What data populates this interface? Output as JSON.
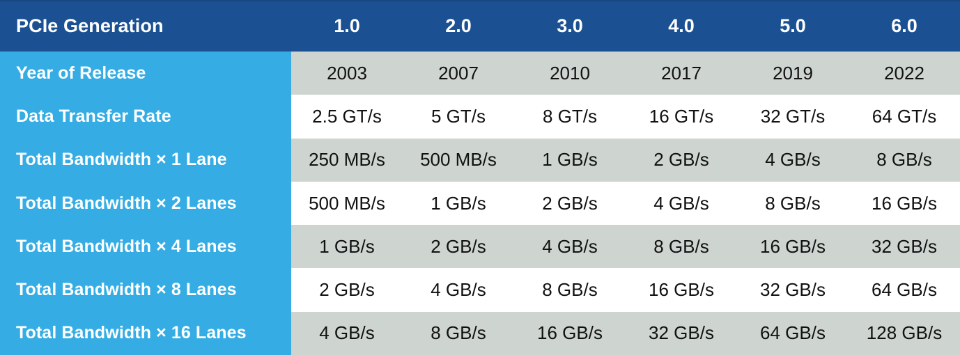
{
  "table": {
    "header": {
      "label": "PCIe Generation",
      "generations": [
        "1.0",
        "2.0",
        "3.0",
        "4.0",
        "5.0",
        "6.0"
      ]
    },
    "rows": [
      {
        "label": "Year of Release",
        "values": [
          "2003",
          "2007",
          "2010",
          "2017",
          "2019",
          "2022"
        ],
        "shade": "gray"
      },
      {
        "label": "Data Transfer Rate",
        "values": [
          "2.5 GT/s",
          "5 GT/s",
          "8 GT/s",
          "16 GT/s",
          "32 GT/s",
          "64 GT/s"
        ],
        "shade": "white"
      },
      {
        "label": "Total Bandwidth × 1 Lane",
        "values": [
          "250 MB/s",
          "500 MB/s",
          "1 GB/s",
          "2 GB/s",
          "4 GB/s",
          "8 GB/s"
        ],
        "shade": "gray"
      },
      {
        "label": "Total Bandwidth × 2 Lanes",
        "values": [
          "500 MB/s",
          "1 GB/s",
          "2 GB/s",
          "4 GB/s",
          "8 GB/s",
          "16 GB/s"
        ],
        "shade": "white"
      },
      {
        "label": "Total Bandwidth × 4 Lanes",
        "values": [
          "1 GB/s",
          "2 GB/s",
          "4 GB/s",
          "8 GB/s",
          "16 GB/s",
          "32 GB/s"
        ],
        "shade": "gray"
      },
      {
        "label": "Total Bandwidth × 8 Lanes",
        "values": [
          "2 GB/s",
          "4 GB/s",
          "8 GB/s",
          "16 GB/s",
          "32 GB/s",
          "64 GB/s"
        ],
        "shade": "white"
      },
      {
        "label": "Total Bandwidth × 16 Lanes",
        "values": [
          "4 GB/s",
          "8 GB/s",
          "16 GB/s",
          "32 GB/s",
          "64 GB/s",
          "128 GB/s"
        ],
        "shade": "gray"
      }
    ]
  },
  "colors": {
    "header_background": "#1b5192",
    "label_column_background": "#35ade4",
    "row_shade_gray": "#ced4cf",
    "row_shade_white": "#ffffff",
    "header_text": "#ffffff",
    "label_text": "#ffffff",
    "cell_text": "#111111"
  },
  "chart_data": {
    "type": "table",
    "title": "PCIe Generation",
    "categories": [
      "1.0",
      "2.0",
      "3.0",
      "4.0",
      "5.0",
      "6.0"
    ],
    "series": [
      {
        "name": "Year of Release",
        "values": [
          2003,
          2007,
          2010,
          2017,
          2019,
          2022
        ]
      },
      {
        "name": "Data Transfer Rate (GT/s)",
        "values": [
          2.5,
          5,
          8,
          16,
          32,
          64
        ]
      },
      {
        "name": "Total Bandwidth × 1 Lane (MB/s)",
        "values": [
          250,
          500,
          1000,
          2000,
          4000,
          8000
        ]
      },
      {
        "name": "Total Bandwidth × 2 Lanes (MB/s)",
        "values": [
          500,
          1000,
          2000,
          4000,
          8000,
          16000
        ]
      },
      {
        "name": "Total Bandwidth × 4 Lanes (MB/s)",
        "values": [
          1000,
          2000,
          4000,
          8000,
          16000,
          32000
        ]
      },
      {
        "name": "Total Bandwidth × 8 Lanes (MB/s)",
        "values": [
          2000,
          4000,
          8000,
          16000,
          32000,
          64000
        ]
      },
      {
        "name": "Total Bandwidth × 16 Lanes (MB/s)",
        "values": [
          4000,
          8000,
          16000,
          32000,
          64000,
          128000
        ]
      }
    ],
    "xlabel": "PCIe Generation",
    "ylabel": "",
    "legend_position": "none",
    "grid": false
  }
}
